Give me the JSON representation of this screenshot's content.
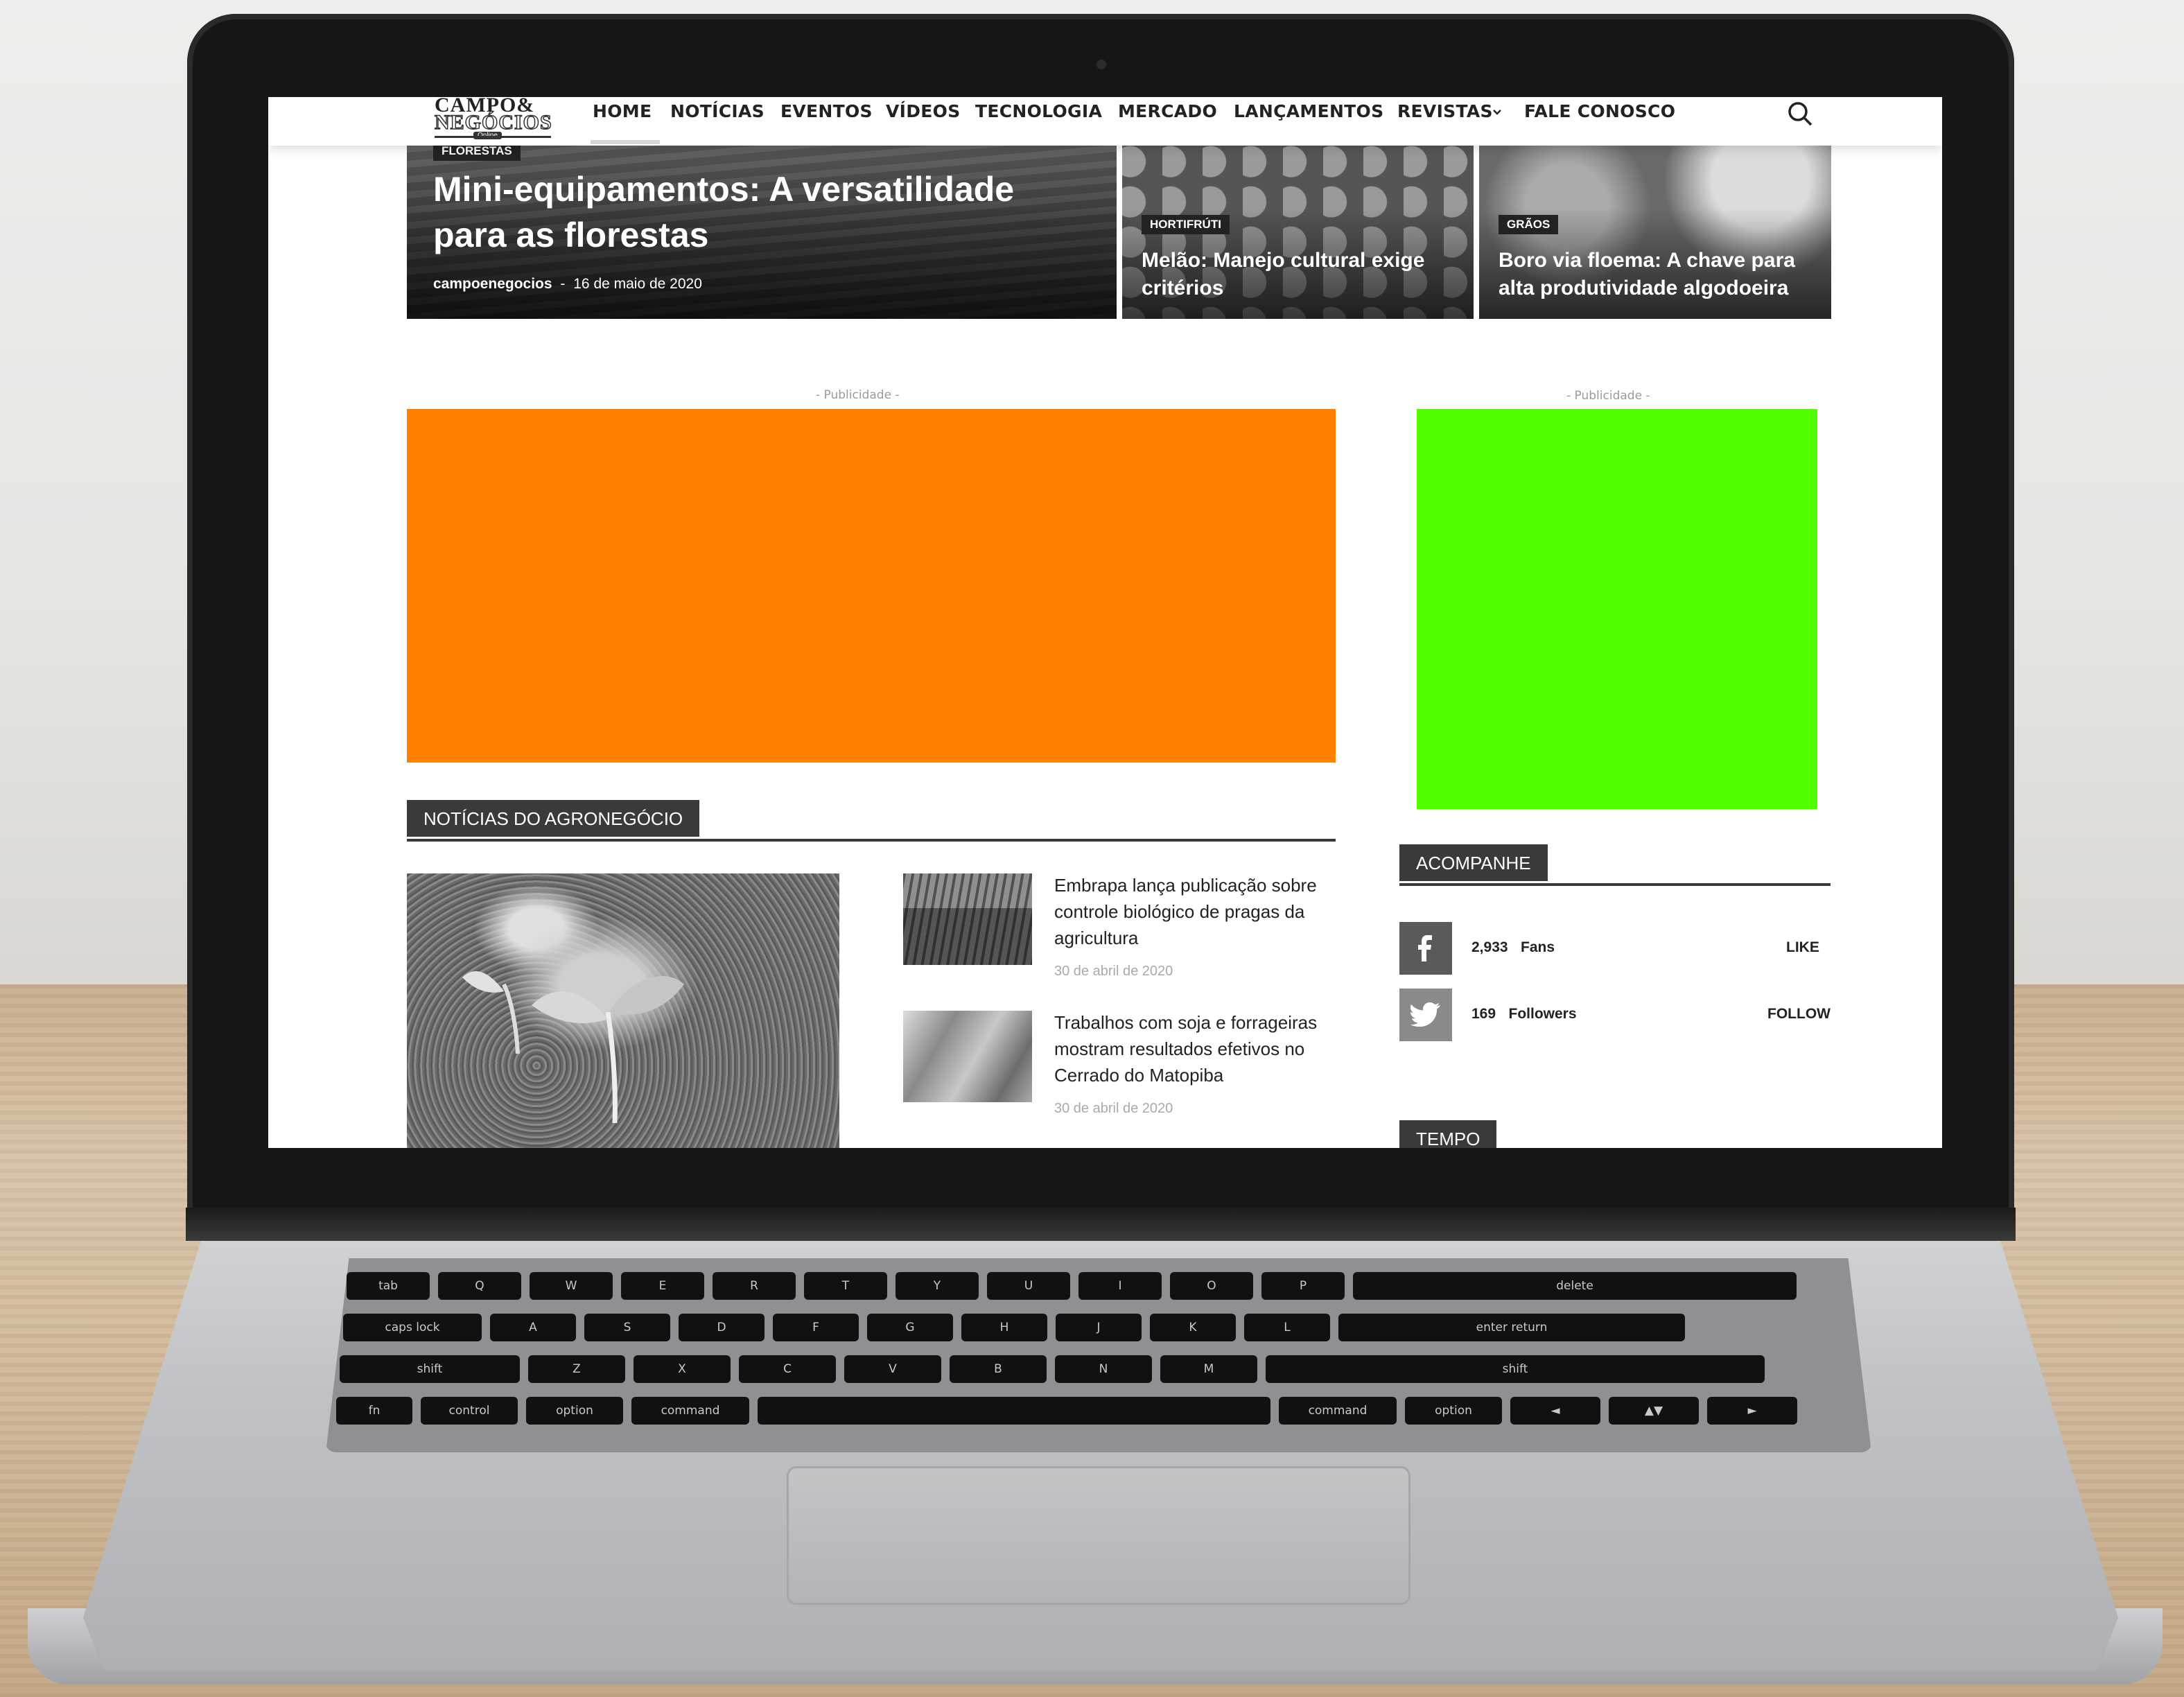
{
  "site": {
    "logo": {
      "line1": "CAMPO&",
      "line2": "NEGÓCIOS",
      "line3": "Online"
    },
    "nav": [
      {
        "label": "HOME"
      },
      {
        "label": "NOTÍCIAS"
      },
      {
        "label": "EVENTOS"
      },
      {
        "label": "VÍDEOS"
      },
      {
        "label": "TECNOLOGIA"
      },
      {
        "label": "MERCADO"
      },
      {
        "label": "LANÇAMENTOS"
      },
      {
        "label": "REVISTAS"
      },
      {
        "label": "FALE CONOSCO"
      }
    ],
    "hero": {
      "main": {
        "tag": "FLORESTAS",
        "title": "Mini-equipamentos: A versatilidade para as florestas",
        "author": "campoenegocios",
        "separator": "-",
        "date": "16 de maio de 2020"
      },
      "second": {
        "tag": "HORTIFRÚTI",
        "title": "Melão: Manejo cultural exige critérios"
      },
      "third": {
        "tag": "GRÃOS",
        "title": "Boro via floema: A chave para alta produtividade algodoeira"
      }
    },
    "ads": {
      "label": "- Publicidade -",
      "main_color": "#ff8000",
      "side_color": "#52ff00"
    },
    "news_block": {
      "heading": "NOTÍCIAS DO AGRONEGÓCIO",
      "items": [
        {
          "title": "Embrapa lança publicação sobre controle biológico de pragas da agricultura",
          "date": "30 de abril de 2020"
        },
        {
          "title": "Trabalhos com soja e forrageiras mostram resultados efetivos no Cerrado do Matopiba",
          "date": "30 de abril de 2020"
        }
      ]
    },
    "follow_block": {
      "heading": "ACOMPANHE",
      "facebook": {
        "icon": "facebook-icon",
        "count": "2,933",
        "unit": "Fans",
        "action": "LIKE"
      },
      "twitter": {
        "icon": "twitter-icon",
        "count": "169",
        "unit": "Followers",
        "action": "FOLLOW"
      }
    },
    "weather_block": {
      "heading": "TEMPO"
    }
  },
  "keyboard": {
    "row1": [
      "tab",
      "Q",
      "W",
      "E",
      "R",
      "T",
      "Y",
      "U",
      "I",
      "O",
      "P",
      "delete"
    ],
    "row2": [
      "caps lock",
      "A",
      "S",
      "D",
      "F",
      "G",
      "H",
      "J",
      "K",
      "L",
      "enter return"
    ],
    "row3": [
      "shift",
      "Z",
      "X",
      "C",
      "V",
      "B",
      "N",
      "M",
      "shift"
    ],
    "row4": [
      "fn",
      "control",
      "option",
      "command",
      "command",
      "option"
    ]
  }
}
